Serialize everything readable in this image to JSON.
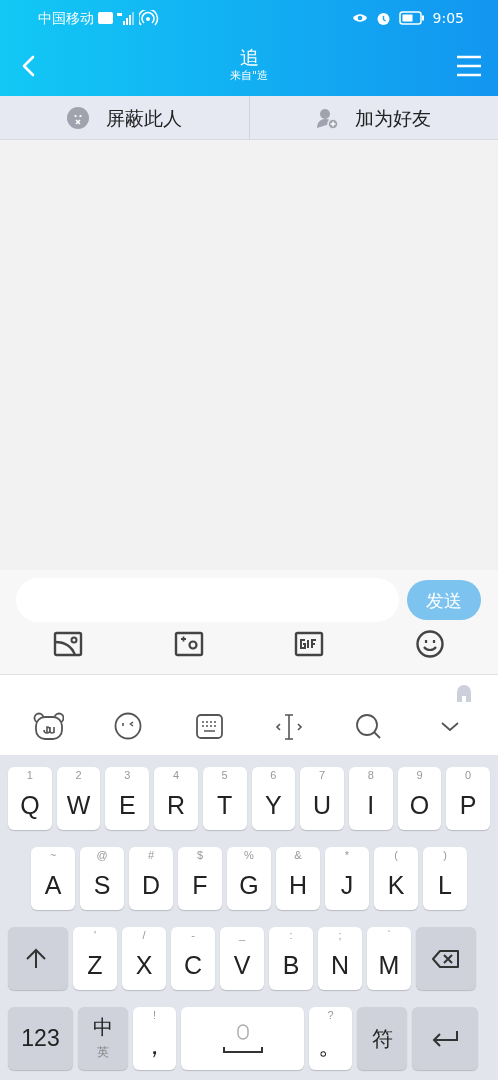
{
  "status_bar": {
    "carrier": "中国移动",
    "time": "9:05"
  },
  "header": {
    "title": "追",
    "subtitle": "来自\"造"
  },
  "actions": [
    {
      "label": "屏蔽此人",
      "kind": "block"
    },
    {
      "label": "加为好友",
      "kind": "add"
    }
  ],
  "composer": {
    "send": "发送",
    "disabled": true
  },
  "keyboard": {
    "rows": [
      [
        {
          "kind": "letter",
          "label": "Q",
          "hint": "1"
        },
        {
          "kind": "letter",
          "label": "W",
          "hint": "2"
        },
        {
          "kind": "letter",
          "label": "E",
          "hint": "3"
        },
        {
          "kind": "letter",
          "label": "R",
          "hint": "4"
        },
        {
          "kind": "letter",
          "label": "T",
          "hint": "5"
        },
        {
          "kind": "letter",
          "label": "Y",
          "hint": "6"
        },
        {
          "kind": "letter",
          "label": "U",
          "hint": "7"
        },
        {
          "kind": "letter",
          "label": "I",
          "hint": "8"
        },
        {
          "kind": "letter",
          "label": "O",
          "hint": "9"
        },
        {
          "kind": "letter",
          "label": "P",
          "hint": "0"
        }
      ],
      [
        {
          "kind": "letter",
          "label": "A",
          "hint": "~"
        },
        {
          "kind": "letter",
          "label": "S",
          "hint": "@"
        },
        {
          "kind": "letter",
          "label": "D",
          "hint": "#"
        },
        {
          "kind": "letter",
          "label": "F",
          "hint": "$"
        },
        {
          "kind": "letter",
          "label": "G",
          "hint": "%"
        },
        {
          "kind": "letter",
          "label": "H",
          "hint": "&"
        },
        {
          "kind": "letter",
          "label": "J",
          "hint": "*"
        },
        {
          "kind": "letter",
          "label": "K",
          "hint": "("
        },
        {
          "kind": "letter",
          "label": "L",
          "hint": ")"
        }
      ],
      [
        {
          "kind": "shift"
        },
        {
          "kind": "letter",
          "label": "Z",
          "hint": "'"
        },
        {
          "kind": "letter",
          "label": "X",
          "hint": "/"
        },
        {
          "kind": "letter",
          "label": "C",
          "hint": "-"
        },
        {
          "kind": "letter",
          "label": "V",
          "hint": "_"
        },
        {
          "kind": "letter",
          "label": "B",
          "hint": ":"
        },
        {
          "kind": "letter",
          "label": "N",
          "hint": ";"
        },
        {
          "kind": "letter",
          "label": "M",
          "hint": "`"
        },
        {
          "kind": "delete"
        }
      ],
      [
        {
          "kind": "num",
          "label": "123"
        },
        {
          "kind": "lang",
          "label": "中",
          "hint": "英"
        },
        {
          "kind": "punct",
          "label": "，",
          "hint": "!"
        },
        {
          "kind": "space"
        },
        {
          "kind": "punct",
          "label": "。",
          "hint": "?"
        },
        {
          "kind": "sym",
          "label": "符"
        },
        {
          "kind": "enter"
        }
      ]
    ]
  }
}
